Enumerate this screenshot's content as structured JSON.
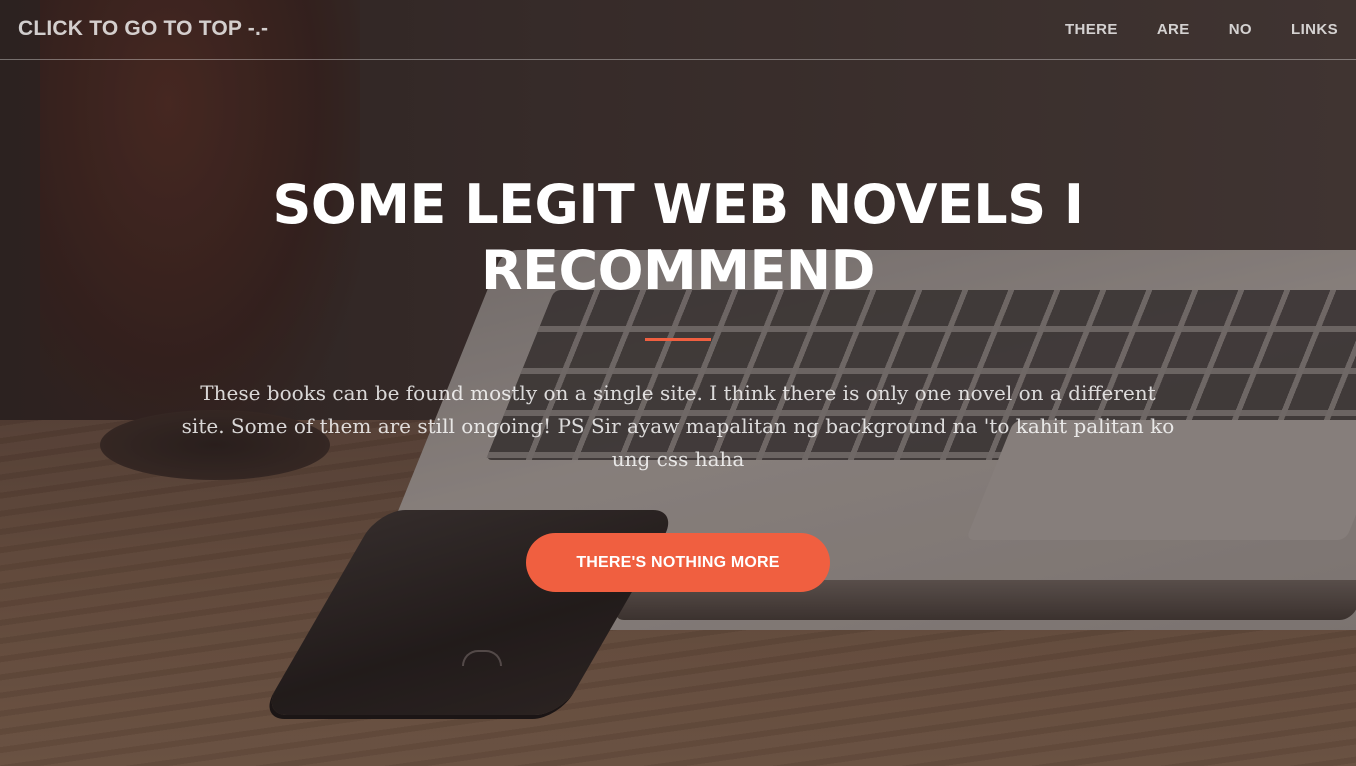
{
  "navbar": {
    "brand": "CLICK TO GO TO TOP -.-",
    "links": [
      "THERE",
      "ARE",
      "NO",
      "LINKS"
    ]
  },
  "hero": {
    "title": "SOME LEGIT WEB NOVELS I RECOMMEND",
    "description": "These books can be found mostly on a single site. I think there is only one novel on a different site. Some of them are still ongoing! PS Sir ayaw mapalitan ng background na 'to kahit palitan ko ung css haha",
    "button_label": "THERE'S NOTHING MORE"
  },
  "colors": {
    "accent": "#f05f40",
    "text": "#ffffff"
  }
}
